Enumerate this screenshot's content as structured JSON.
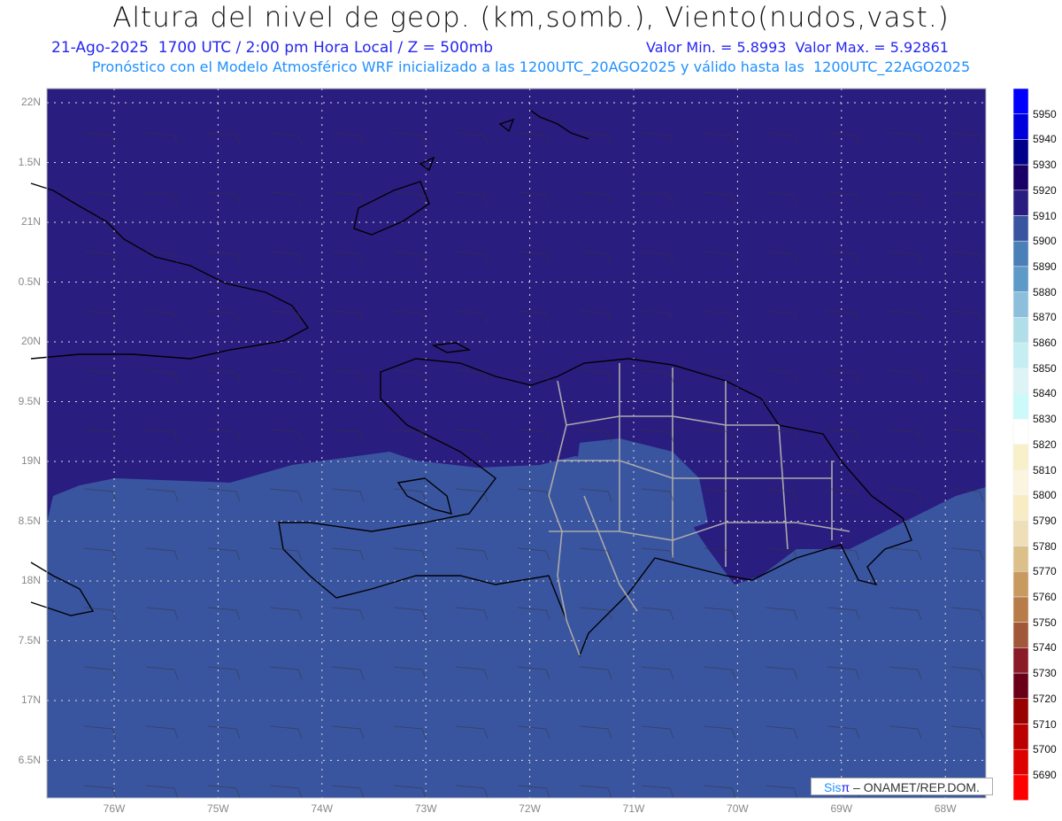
{
  "title": "Altura del nivel de geop. (km,somb.), Viento(nudos,vast.)",
  "subtitle_left": "21-Ago-2025  1700 UTC / 2:00 pm Hora Local / Z = 500mb",
  "subtitle_right": "Valor Min. = 5.8993  Valor Max. = 5.92861",
  "forecast_line": "Pronóstico con el Modelo Atmosférico WRF inicializado a las 1200UTC_20AGO2025 y válido hasta las  1200UTC_22AGO2025",
  "lat_labels": [
    "22N",
    "1.5N",
    "21N",
    "0.5N",
    "20N",
    "9.5N",
    "19N",
    "8.5N",
    "18N",
    "7.5N",
    "17N",
    "6.5N"
  ],
  "lon_labels": [
    "76W",
    "75W",
    "74W",
    "73W",
    "72W",
    "71W",
    "70W",
    "69W",
    "68W"
  ],
  "colorbar": {
    "labels": [
      "5950",
      "5940",
      "5930",
      "5920",
      "5910",
      "5900",
      "5890",
      "5880",
      "5870",
      "5860",
      "5850",
      "5840",
      "5830",
      "5820",
      "5810",
      "5800",
      "5790",
      "5780",
      "5770",
      "5760",
      "5750",
      "5740",
      "5730",
      "5720",
      "5710",
      "5700",
      "5690"
    ],
    "colors": [
      "#0000ff",
      "#0000dd",
      "#00008b",
      "#1a0066",
      "#2a1d80",
      "#3a55a0",
      "#4a7fb8",
      "#5e9ac8",
      "#8dbfdd",
      "#b0dfea",
      "#c5eef2",
      "#ddf4f7",
      "#ccfafa",
      "#ffffff",
      "#f8f0c8",
      "#fbf5e0",
      "#f7ecc4",
      "#eedfb8",
      "#dcc08a",
      "#c89a60",
      "#b87c48",
      "#a05838",
      "#8a1c28",
      "#6a0018",
      "#990000",
      "#bb0000",
      "#dd0000",
      "#ff0000"
    ]
  },
  "fill_colors": {
    "high": "#2a1d80",
    "low": "#3a55a0"
  },
  "credit": {
    "brand": "Sis",
    "brand_symbol": "π",
    "text": "– ONAMET/REP.DOM."
  }
}
